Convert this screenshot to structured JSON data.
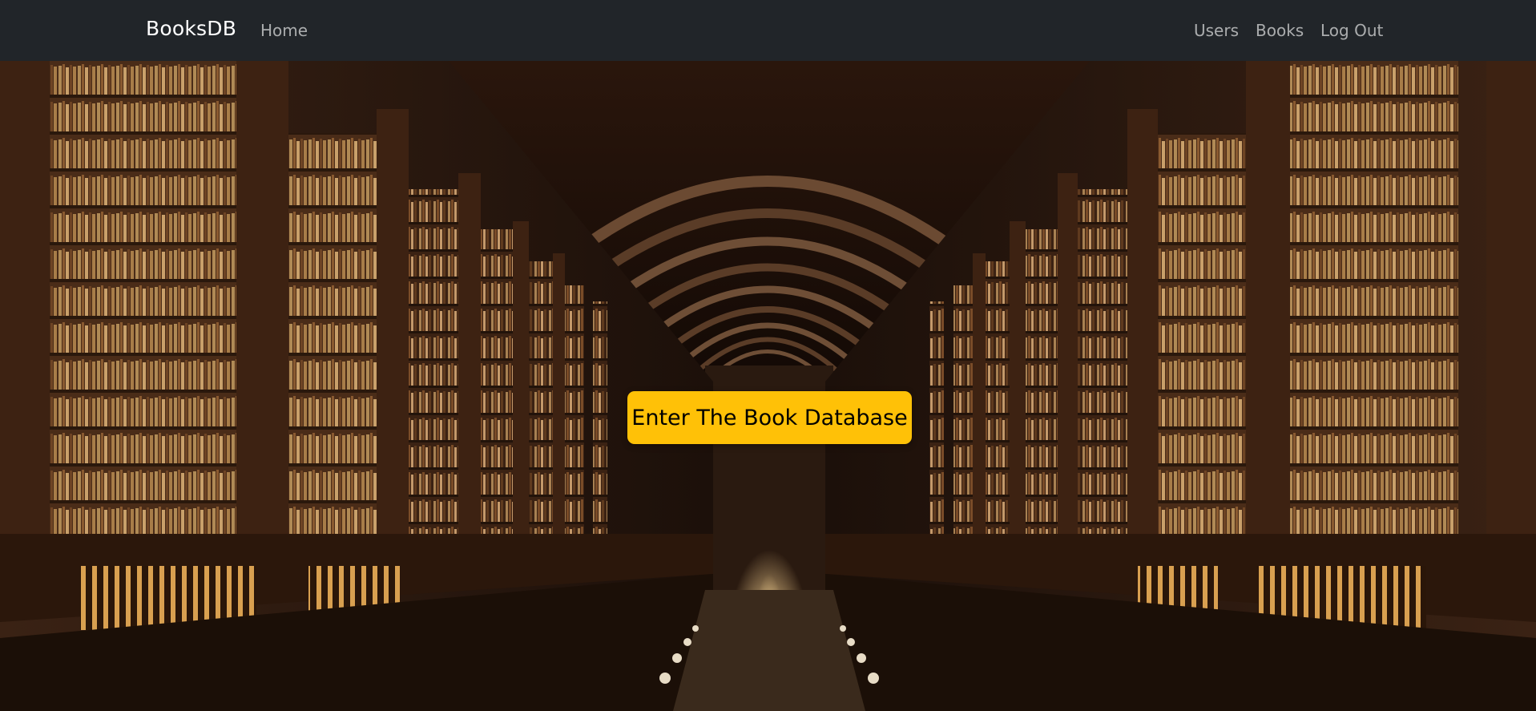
{
  "navbar": {
    "brand": "BooksDB",
    "left_links": [
      {
        "label": "Home"
      }
    ],
    "right_links": [
      {
        "label": "Users"
      },
      {
        "label": "Books"
      },
      {
        "label": "Log Out"
      }
    ]
  },
  "hero": {
    "background": "library-hall-photo",
    "cta_label": "Enter The Book Database"
  },
  "colors": {
    "navbar_bg": "#212529",
    "brand_text": "#ffffff",
    "nav_link_text": "#9a9da0",
    "cta_bg": "#ffc107",
    "cta_text": "#000000"
  }
}
